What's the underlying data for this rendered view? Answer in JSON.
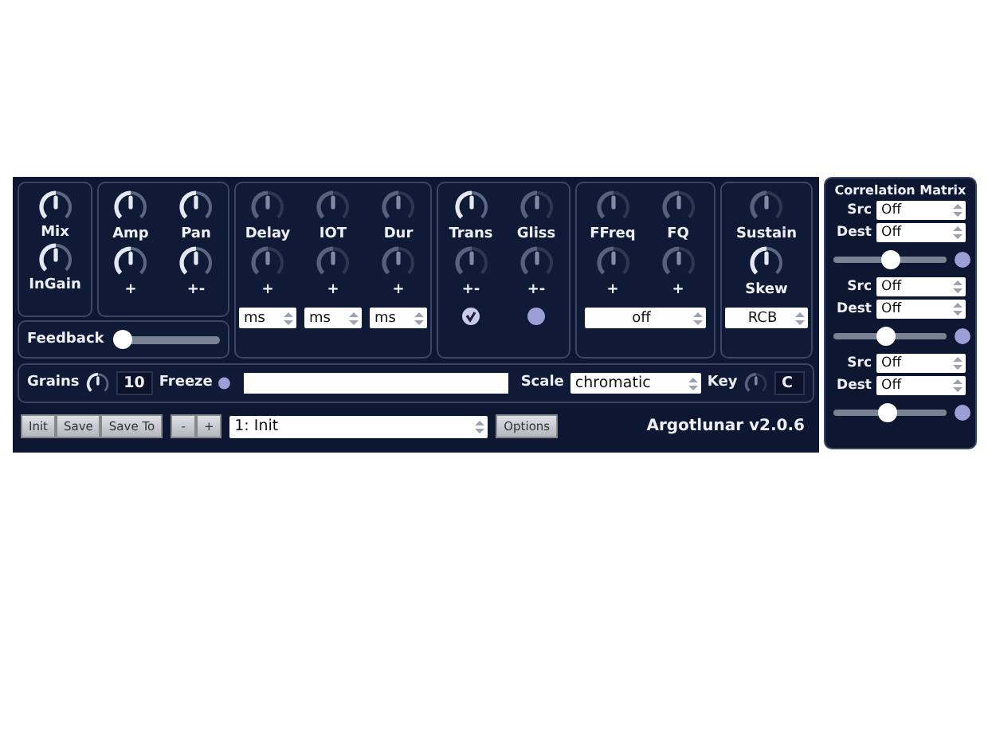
{
  "mix_panel": {
    "knobs": [
      {
        "label": "Mix",
        "active": true
      },
      {
        "label": "InGain",
        "active": true
      }
    ]
  },
  "feedback": {
    "label": "Feedback",
    "level": 0.0
  },
  "sections": [
    {
      "columns": [
        {
          "label": "Amp",
          "knob": {
            "active": true
          },
          "mod_label": "+",
          "mod": {
            "active": true
          }
        },
        {
          "label": "Pan",
          "knob": {
            "active": true
          },
          "mod_label": "+-",
          "mod": {
            "active": true
          }
        }
      ]
    },
    {
      "columns": [
        {
          "label": "Delay",
          "knob": {
            "active": false
          },
          "mod_label": "+",
          "mod": {
            "active": false
          },
          "footer": {
            "kind": "menu",
            "value": "ms"
          }
        },
        {
          "label": "IOT",
          "knob": {
            "active": false
          },
          "mod_label": "+",
          "mod": {
            "active": false
          },
          "footer": {
            "kind": "menu",
            "value": "ms"
          }
        },
        {
          "label": "Dur",
          "knob": {
            "active": false
          },
          "mod_label": "+",
          "mod": {
            "active": false
          },
          "footer": {
            "kind": "menu",
            "value": "ms"
          }
        }
      ]
    },
    {
      "columns": [
        {
          "label": "Trans",
          "knob": {
            "active": true
          },
          "mod_label": "+-",
          "mod": {
            "active": false
          },
          "footer": {
            "kind": "check",
            "checked": true
          }
        },
        {
          "label": "Gliss",
          "knob": {
            "active": false
          },
          "mod_label": "+-",
          "mod": {
            "active": false
          },
          "footer": {
            "kind": "check",
            "checked": false
          }
        }
      ]
    },
    {
      "columns": [
        {
          "label": "FFreq",
          "knob": {
            "active": false
          },
          "mod_label": "+",
          "mod": {
            "active": false
          }
        },
        {
          "label": "FQ",
          "knob": {
            "active": false
          },
          "mod_label": "+",
          "mod": {
            "active": false
          }
        }
      ],
      "menu": "off"
    },
    {
      "columns": [
        {
          "label": "Sustain",
          "knob": {
            "active": false
          },
          "mod_label": "Skew",
          "mod": {
            "active": true
          }
        }
      ],
      "menu": "RCB"
    }
  ],
  "grains_bar": {
    "grains_label": "Grains",
    "grains_knob": {
      "active": true
    },
    "grains_value": "10",
    "freeze_label": "Freeze",
    "freeze_on": false,
    "scale_label": "Scale",
    "scale_value": "chromatic",
    "key_label": "Key",
    "key_knob": {
      "active": false
    },
    "key_value": "C"
  },
  "bottom_bar": {
    "buttons": [
      "Init",
      "Save",
      "Save To"
    ],
    "steppers": [
      "-",
      "+"
    ],
    "preset": "1: Init",
    "options": "Options",
    "title": "Argotlunar v2.0.6"
  },
  "correlation": {
    "title": "Correlation Matrix",
    "rows": [
      {
        "src_label": "Src",
        "src": "Off",
        "dest_label": "Dest",
        "dest": "Off",
        "level": 0.5,
        "on": false
      },
      {
        "src_label": "Src",
        "src": "Off",
        "dest_label": "Dest",
        "dest": "Off",
        "level": 0.46,
        "on": false
      },
      {
        "src_label": "Src",
        "src": "Off",
        "dest_label": "Dest",
        "dest": "Off",
        "level": 0.48,
        "on": false
      }
    ]
  }
}
